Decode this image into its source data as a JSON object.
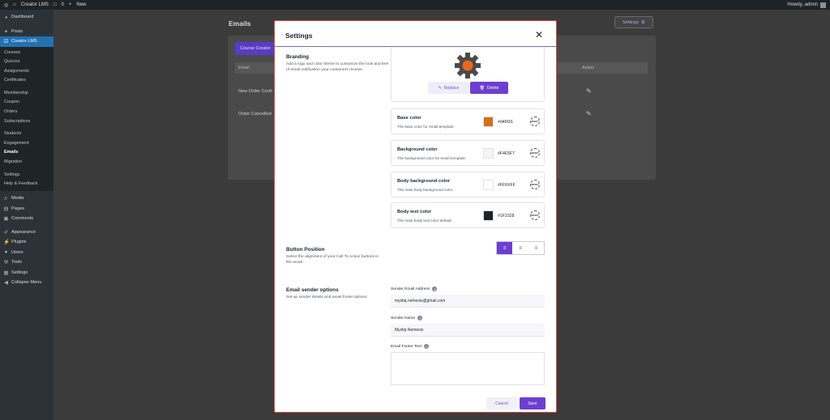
{
  "adminbar": {
    "site_name": "Creator LMS",
    "comments_count": "0",
    "new_label": "New",
    "greeting": "Howdy, admin"
  },
  "sidebar": {
    "top_items": [
      {
        "label": "Dashboard",
        "icon": "dashboard-icon"
      },
      {
        "label": "Posts",
        "icon": "pin-icon"
      },
      {
        "label": "Creator LMS",
        "icon": "lms-icon"
      }
    ],
    "submenu": [
      "Courses",
      "Quizzes",
      "Assignments",
      "Certificates",
      "Membership",
      "Coupon",
      "Orders",
      "Subscriptions",
      "Students",
      "Engagement",
      "Emails",
      "Migration",
      "Settings",
      "Help & Feedback"
    ],
    "current": "Emails",
    "bottom_items": [
      {
        "label": "Media"
      },
      {
        "label": "Pages"
      },
      {
        "label": "Comments"
      },
      {
        "label": "Appearance"
      },
      {
        "label": "Plugins"
      },
      {
        "label": "Users"
      },
      {
        "label": "Tools"
      },
      {
        "label": "Settings"
      },
      {
        "label": "Collapse Menu"
      }
    ]
  },
  "main": {
    "title": "Emails",
    "settings_label": "Settings",
    "tab_label": "Course Creator",
    "col_email": "Email",
    "col_action": "Action",
    "rows": [
      "New Order Confi",
      "Order Cancelled"
    ]
  },
  "modal": {
    "title": "Settings",
    "branding": {
      "title": "Branding",
      "desc": "Add a logo and color theme to customize the look and feel of email notification your customers receive.",
      "replace": "Replace",
      "delete": "Delete"
    },
    "colors": [
      {
        "title": "Base color",
        "desc": "The base color for email template.",
        "hex": "#d46f16",
        "swatch": "#d46f16"
      },
      {
        "title": "Background color",
        "desc": "The background color for email template.",
        "hex": "#F4F5F7",
        "swatch": "#F4F5F7"
      },
      {
        "title": "Body background color",
        "desc": "The main body background color.",
        "hex": "#FFFFFF",
        "swatch": "#FFFFFF"
      },
      {
        "title": "Body text color",
        "desc": "The main body text color default.",
        "hex": "#1F2328",
        "swatch": "#1F2328"
      }
    ],
    "reset_label": "RESET",
    "button_position": {
      "title": "Button Position",
      "desc": "Select the alignment of your Call To Action buttons in the email."
    },
    "sender": {
      "title": "Email sender options",
      "desc": "Set up sender details and email footer options.",
      "email_label": "Sender Email Address",
      "email_value": "mystiq.nemesis@gmail.com",
      "name_label": "Sender Name",
      "name_value": "Mystiq Nemesis",
      "footer_label": "Email Footer Text"
    },
    "cancel": "Cancel",
    "save": "Save"
  },
  "colors": {
    "accent": "#6c3fd1",
    "wp_blue": "#2271b1",
    "gear_orange": "#e8691e",
    "modal_border": "#e0453c"
  }
}
